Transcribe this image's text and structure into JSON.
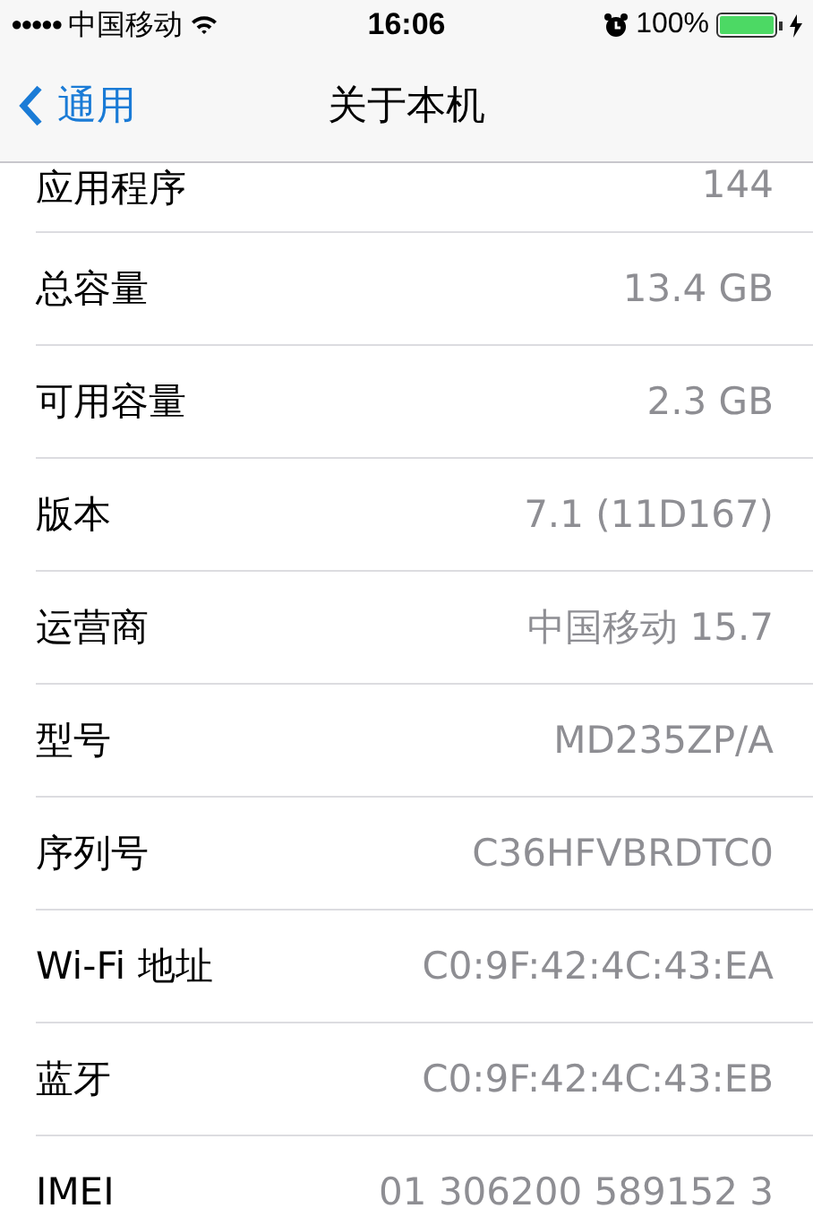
{
  "status_bar": {
    "signal": "●●●●●",
    "carrier": "中国移动",
    "time": "16:06",
    "battery_percent": "100%",
    "charging": true
  },
  "nav_bar": {
    "back": "通用",
    "title": "关于本机"
  },
  "rows": [
    {
      "label": "应用程序",
      "value": "144"
    },
    {
      "label": "总容量",
      "value": "13.4 GB"
    },
    {
      "label": "可用容量",
      "value": "2.3 GB"
    },
    {
      "label": "版本",
      "value": "7.1 (11D167)"
    },
    {
      "label": "运营商",
      "value": "中国移动 15.7"
    },
    {
      "label": "型号",
      "value": "MD235ZP/A"
    },
    {
      "label": "序列号",
      "value": "C36HFVBRDTC0"
    },
    {
      "label": "Wi-Fi 地址",
      "value": "C0:9F:42:4C:43:EA"
    },
    {
      "label": "蓝牙",
      "value": "C0:9F:42:4C:43:EB"
    },
    {
      "label": "IMEI",
      "value": "01 306200 589152 3"
    }
  ]
}
